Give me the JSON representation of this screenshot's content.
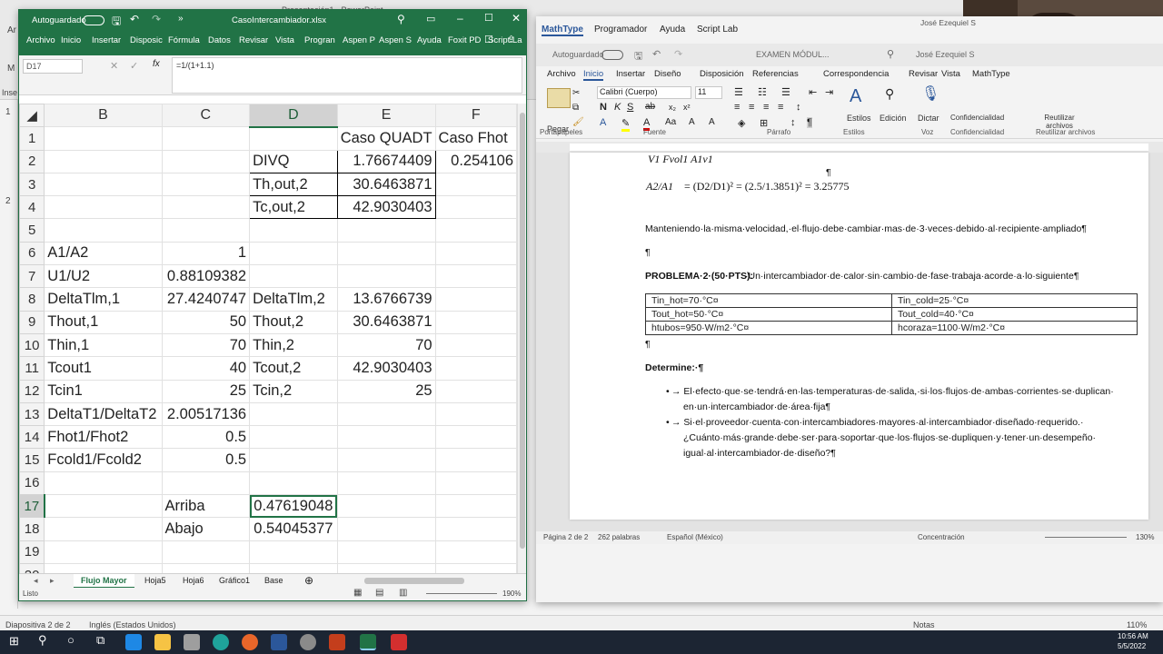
{
  "ppt": {
    "title": "Presentación1 - PowerPoint",
    "slide_numbers": [
      "1",
      "2"
    ],
    "status_left": "Diapositiva 2 de 2",
    "status_lang": "Inglés (Estados Unidos)",
    "notes": "Notas",
    "zoom": "110%",
    "menu_short": [
      "Ar",
      "M",
      "Inse"
    ]
  },
  "excel": {
    "autosave_label": "Autoguardado",
    "filename": "CasoIntercambiador.xlsx",
    "menu": [
      "Archivo",
      "Inicio",
      "Insertar",
      "Disposic",
      "Fórmula",
      "Datos",
      "Revisar",
      "Vista",
      "Progran",
      "Aspen P",
      "Aspen S",
      "Ayuda",
      "Foxit PD",
      "Script La"
    ],
    "namebox": "D17",
    "fx": "fx",
    "formula": "=1/(1+1.1)",
    "columns": [
      "B",
      "C",
      "D",
      "E",
      "F"
    ],
    "rows": [
      {
        "n": "1",
        "B": "",
        "C": "",
        "D": "",
        "E": "Caso QUADT",
        "F": "Caso Fhot"
      },
      {
        "n": "2",
        "B": "",
        "C": "",
        "D": "DIVQ",
        "E": "1.76674409",
        "F": "0.254106"
      },
      {
        "n": "3",
        "B": "",
        "C": "",
        "D": "Th,out,2",
        "E": "30.6463871",
        "F": ""
      },
      {
        "n": "4",
        "B": "",
        "C": "",
        "D": "Tc,out,2",
        "E": "42.9030403",
        "F": ""
      },
      {
        "n": "5",
        "B": "",
        "C": "",
        "D": "",
        "E": "",
        "F": ""
      },
      {
        "n": "6",
        "B": "A1/A2",
        "C": "1",
        "D": "",
        "E": "",
        "F": ""
      },
      {
        "n": "7",
        "B": "U1/U2",
        "C": "0.88109382",
        "D": "",
        "E": "",
        "F": ""
      },
      {
        "n": "8",
        "B": "DeltaTlm,1",
        "C": "27.4240747",
        "D": "DeltaTlm,2",
        "E": "13.6766739",
        "F": ""
      },
      {
        "n": "9",
        "B": "Thout,1",
        "C": "50",
        "D": "Thout,2",
        "E": "30.6463871",
        "F": ""
      },
      {
        "n": "10",
        "B": "Thin,1",
        "C": "70",
        "D": "Thin,2",
        "E": "70",
        "F": ""
      },
      {
        "n": "11",
        "B": "Tcout1",
        "C": "40",
        "D": "Tcout,2",
        "E": "42.9030403",
        "F": ""
      },
      {
        "n": "12",
        "B": "Tcin1",
        "C": "25",
        "D": "Tcin,2",
        "E": "25",
        "F": ""
      },
      {
        "n": "13",
        "B": "DeltaT1/DeltaT2",
        "C": "2.00517136",
        "D": "",
        "E": "",
        "F": ""
      },
      {
        "n": "14",
        "B": "Fhot1/Fhot2",
        "C": "0.5",
        "D": "",
        "E": "",
        "F": ""
      },
      {
        "n": "15",
        "B": "Fcold1/Fcold2",
        "C": "0.5",
        "D": "",
        "E": "",
        "F": ""
      },
      {
        "n": "16",
        "B": "",
        "C": "",
        "D": "",
        "E": "",
        "F": ""
      },
      {
        "n": "17",
        "B": "",
        "C": "Arriba",
        "D": "0.47619048",
        "E": "",
        "F": ""
      },
      {
        "n": "18",
        "B": "",
        "C": "Abajo",
        "D": "0.54045377",
        "E": "",
        "F": ""
      },
      {
        "n": "19",
        "B": "",
        "C": "",
        "D": "",
        "E": "",
        "F": ""
      },
      {
        "n": "20",
        "B": "",
        "C": "",
        "D": "",
        "E": "",
        "F": ""
      }
    ],
    "sheets": [
      "Flujo Mayor",
      "Hoja5",
      "Hoja6",
      "Gráfico1",
      "Base"
    ],
    "status_left": "Listo",
    "zoom": "190%"
  },
  "word": {
    "top_tabs": [
      "MathType",
      "Programador",
      "Ayuda",
      "Script Lab"
    ],
    "user": "José Ezequiel S",
    "autosave_label": "Autoguardado",
    "doc_title": "EXAMEN MÓDUL...",
    "menu": [
      "Archivo",
      "Inicio",
      "Insertar",
      "Diseño",
      "Disposición",
      "Referencias",
      "Correspondencia",
      "Revisar",
      "Vista",
      "MathType"
    ],
    "font_name": "Calibri (Cuerpo)",
    "font_size": "11",
    "ribbon_groups": [
      "Portapapeles",
      "Fuente",
      "Párrafo",
      "Estilos",
      "Voz",
      "Confidencialidad",
      "Reutilizar archivos"
    ],
    "ribbon_buttons": [
      "Pegar",
      "Estilos",
      "Edición",
      "Dictar",
      "Confidencialidad",
      "Reutilizar archivos"
    ],
    "eq1_left": "A2/A1",
    "eq1": "= (D2/D1)² = (2.5/1.3851)² = 3.25775",
    "eq0": "V1  Fvol1  A1v1",
    "para1": "Manteniendo·la·misma·velocidad,·el·flujo·debe·cambiar·mas·de·3·veces·debido·al·recipiente·ampliado¶",
    "pilcrow": "¶",
    "problem_bold": "PROBLEMA·2·(50·PTS):",
    "problem_rest": "·Un·intercambiador·de·calor·sin·cambio·de·fase·trabaja·acorde·a·lo·siguiente¶",
    "table": [
      [
        "Tin_hot=70·°C¤",
        "Tin_cold=25·°C¤"
      ],
      [
        "Tout_hot=50·°C¤",
        "Tout_cold=40·°C¤"
      ],
      [
        "htubos=950·W/m2·°C¤",
        "hcoraza=1100·W/m2·°C¤"
      ]
    ],
    "determine": "Determine:·¶",
    "bullet1a": "→ El·efecto·que·se·tendrá·en·las·temperaturas·de·salida,·si·los·flujos·de·ambas·corrientes·se·duplican·",
    "bullet1b": "en·un·intercambiador·de·área·fija¶",
    "bullet2a": "→ Si·el·proveedor·cuenta·con·intercambiadores·mayores·al·intercambiador·diseñado·requerido.·",
    "bullet2b": "¿Cuánto·más·grande·debe·ser·para·soportar·que·los·flujos·se·dupliquen·y·tener·un·desempeño·",
    "bullet2c": "igual·al·intercambiador·de·diseño?¶",
    "status_page": "Página 2 de 2",
    "status_words": "262 palabras",
    "status_lang": "Español (México)",
    "status_focus": "Concentración",
    "zoom": "130%"
  },
  "taskbar": {
    "time": "10:56 AM",
    "date": "5/5/2022"
  },
  "colors": {
    "excel_green": "#217346",
    "word_blue": "#2b579a"
  }
}
